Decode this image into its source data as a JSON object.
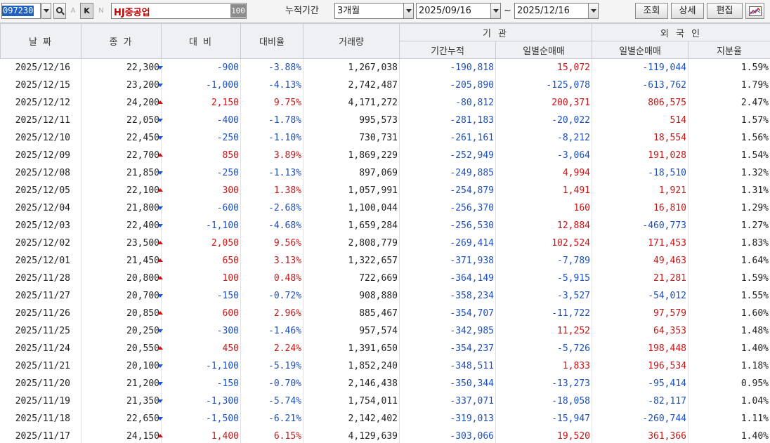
{
  "toolbar": {
    "stock_code": "097230",
    "letter_a": "A",
    "letter_k": "K",
    "letter_n": "N",
    "stock_name": "HJ중공업",
    "badge": "100",
    "period_label": "누적기간",
    "period_value": "3개월",
    "date_from": "2025/09/16",
    "tilde": "~",
    "date_to": "2025/12/16",
    "btn_query": "조회",
    "btn_detail": "상세",
    "btn_edit": "편집"
  },
  "columns": {
    "date": "날 짜",
    "close": "종 가",
    "change": "대 비",
    "change_rate": "대비율",
    "volume": "거래량",
    "inst_group": "기 관",
    "inst_cum": "기간누적",
    "inst_daily": "일별순매매",
    "foreign_group": "외 국 인",
    "foreign_daily": "일별순매매",
    "foreign_ratio": "지분율"
  },
  "colors": {
    "up": "#c81414",
    "down": "#1a4fc0"
  },
  "rows": [
    {
      "date": "2025/12/16",
      "close": "22,300",
      "dir": "down",
      "change": "-900",
      "rate": "-3.88%",
      "volume": "1,267,038",
      "inst_cum": "-190,818",
      "inst_daily": "15,072",
      "frn_daily": "-119,044",
      "frn_ratio": "1.59%"
    },
    {
      "date": "2025/12/15",
      "close": "23,200",
      "dir": "down",
      "change": "-1,000",
      "rate": "-4.13%",
      "volume": "2,742,487",
      "inst_cum": "-205,890",
      "inst_daily": "-125,078",
      "frn_daily": "-613,762",
      "frn_ratio": "1.79%"
    },
    {
      "date": "2025/12/12",
      "close": "24,200",
      "dir": "up",
      "change": "2,150",
      "rate": "9.75%",
      "volume": "4,171,272",
      "inst_cum": "-80,812",
      "inst_daily": "200,371",
      "frn_daily": "806,575",
      "frn_ratio": "2.47%"
    },
    {
      "date": "2025/12/11",
      "close": "22,050",
      "dir": "down",
      "change": "-400",
      "rate": "-1.78%",
      "volume": "995,573",
      "inst_cum": "-281,183",
      "inst_daily": "-20,022",
      "frn_daily": "514",
      "frn_ratio": "1.57%"
    },
    {
      "date": "2025/12/10",
      "close": "22,450",
      "dir": "down",
      "change": "-250",
      "rate": "-1.10%",
      "volume": "730,731",
      "inst_cum": "-261,161",
      "inst_daily": "-8,212",
      "frn_daily": "18,554",
      "frn_ratio": "1.56%"
    },
    {
      "date": "2025/12/09",
      "close": "22,700",
      "dir": "up",
      "change": "850",
      "rate": "3.89%",
      "volume": "1,869,229",
      "inst_cum": "-252,949",
      "inst_daily": "-3,064",
      "frn_daily": "191,028",
      "frn_ratio": "1.54%"
    },
    {
      "date": "2025/12/08",
      "close": "21,850",
      "dir": "down",
      "change": "-250",
      "rate": "-1.13%",
      "volume": "897,069",
      "inst_cum": "-249,885",
      "inst_daily": "4,994",
      "frn_daily": "-18,510",
      "frn_ratio": "1.32%"
    },
    {
      "date": "2025/12/05",
      "close": "22,100",
      "dir": "up",
      "change": "300",
      "rate": "1.38%",
      "volume": "1,057,991",
      "inst_cum": "-254,879",
      "inst_daily": "1,491",
      "frn_daily": "1,921",
      "frn_ratio": "1.31%"
    },
    {
      "date": "2025/12/04",
      "close": "21,800",
      "dir": "down",
      "change": "-600",
      "rate": "-2.68%",
      "volume": "1,100,044",
      "inst_cum": "-256,370",
      "inst_daily": "160",
      "frn_daily": "16,810",
      "frn_ratio": "1.29%"
    },
    {
      "date": "2025/12/03",
      "close": "22,400",
      "dir": "down",
      "change": "-1,100",
      "rate": "-4.68%",
      "volume": "1,659,284",
      "inst_cum": "-256,530",
      "inst_daily": "12,884",
      "frn_daily": "-460,773",
      "frn_ratio": "1.27%"
    },
    {
      "date": "2025/12/02",
      "close": "23,500",
      "dir": "up",
      "change": "2,050",
      "rate": "9.56%",
      "volume": "2,808,779",
      "inst_cum": "-269,414",
      "inst_daily": "102,524",
      "frn_daily": "171,453",
      "frn_ratio": "1.83%"
    },
    {
      "date": "2025/12/01",
      "close": "21,450",
      "dir": "up",
      "change": "650",
      "rate": "3.13%",
      "volume": "1,322,657",
      "inst_cum": "-371,938",
      "inst_daily": "-7,789",
      "frn_daily": "49,463",
      "frn_ratio": "1.64%"
    },
    {
      "date": "2025/11/28",
      "close": "20,800",
      "dir": "up",
      "change": "100",
      "rate": "0.48%",
      "volume": "722,669",
      "inst_cum": "-364,149",
      "inst_daily": "-5,915",
      "frn_daily": "21,281",
      "frn_ratio": "1.59%"
    },
    {
      "date": "2025/11/27",
      "close": "20,700",
      "dir": "down",
      "change": "-150",
      "rate": "-0.72%",
      "volume": "908,880",
      "inst_cum": "-358,234",
      "inst_daily": "-3,527",
      "frn_daily": "-54,012",
      "frn_ratio": "1.55%"
    },
    {
      "date": "2025/11/26",
      "close": "20,850",
      "dir": "up",
      "change": "600",
      "rate": "2.96%",
      "volume": "885,467",
      "inst_cum": "-354,707",
      "inst_daily": "-11,722",
      "frn_daily": "97,579",
      "frn_ratio": "1.60%"
    },
    {
      "date": "2025/11/25",
      "close": "20,250",
      "dir": "down",
      "change": "-300",
      "rate": "-1.46%",
      "volume": "957,574",
      "inst_cum": "-342,985",
      "inst_daily": "11,252",
      "frn_daily": "64,353",
      "frn_ratio": "1.48%"
    },
    {
      "date": "2025/11/24",
      "close": "20,550",
      "dir": "up",
      "change": "450",
      "rate": "2.24%",
      "volume": "1,391,650",
      "inst_cum": "-354,237",
      "inst_daily": "-5,726",
      "frn_daily": "198,448",
      "frn_ratio": "1.40%"
    },
    {
      "date": "2025/11/21",
      "close": "20,100",
      "dir": "down",
      "change": "-1,100",
      "rate": "-5.19%",
      "volume": "1,852,240",
      "inst_cum": "-348,511",
      "inst_daily": "1,833",
      "frn_daily": "196,534",
      "frn_ratio": "1.18%"
    },
    {
      "date": "2025/11/20",
      "close": "21,200",
      "dir": "down",
      "change": "-150",
      "rate": "-0.70%",
      "volume": "2,146,438",
      "inst_cum": "-350,344",
      "inst_daily": "-13,273",
      "frn_daily": "-95,414",
      "frn_ratio": "0.95%"
    },
    {
      "date": "2025/11/19",
      "close": "21,350",
      "dir": "down",
      "change": "-1,300",
      "rate": "-5.74%",
      "volume": "1,754,011",
      "inst_cum": "-337,071",
      "inst_daily": "-18,058",
      "frn_daily": "-82,117",
      "frn_ratio": "1.04%"
    },
    {
      "date": "2025/11/18",
      "close": "22,650",
      "dir": "down",
      "change": "-1,500",
      "rate": "-6.21%",
      "volume": "2,142,402",
      "inst_cum": "-319,013",
      "inst_daily": "-15,947",
      "frn_daily": "-260,744",
      "frn_ratio": "1.11%"
    },
    {
      "date": "2025/11/17",
      "close": "24,150",
      "dir": "up",
      "change": "1,400",
      "rate": "6.15%",
      "volume": "4,129,639",
      "inst_cum": "-303,066",
      "inst_daily": "19,520",
      "frn_daily": "361,366",
      "frn_ratio": "1.40%"
    }
  ]
}
